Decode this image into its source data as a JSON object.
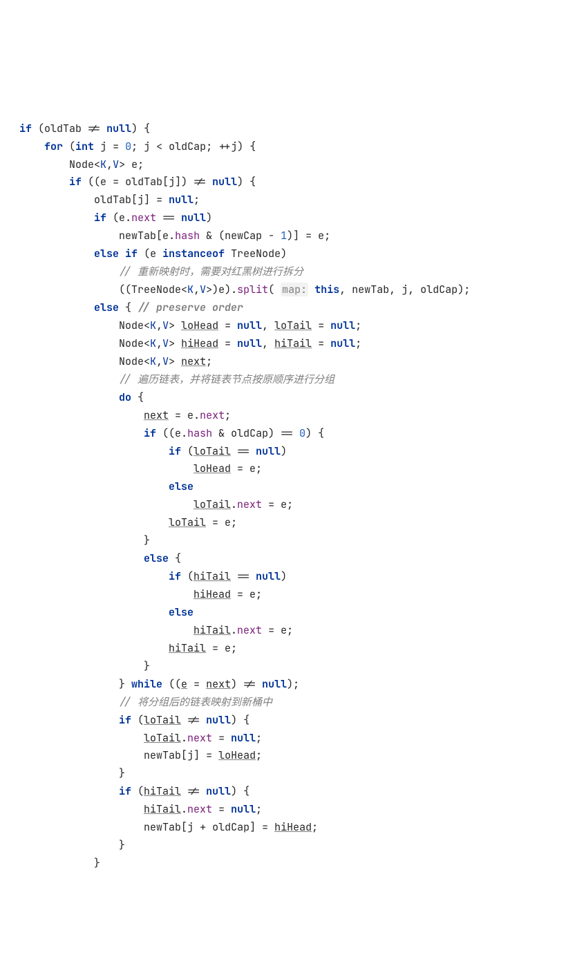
{
  "meta": {
    "language": "Java",
    "context": "HashMap.resize() loop body (decompiled / IDE view)"
  },
  "tokens": {
    "kw_if": "if",
    "kw_else": "else",
    "kw_for": "for",
    "kw_do": "do",
    "kw_while": "while",
    "kw_int": "int",
    "kw_null": "null",
    "kw_instanceof": "instanceof",
    "kw_this": "this",
    "ty_Node": "Node",
    "ty_TreeNode": "TreeNode",
    "ty_K": "K",
    "ty_V": "V",
    "fld_next": "next",
    "fld_hash": "hash",
    "fld_split": "split",
    "var_oldTab": "oldTab",
    "var_newTab": "newTab",
    "var_oldCap": "oldCap",
    "var_newCap": "newCap",
    "var_j": "j",
    "var_e": "e",
    "var_loHead": "loHead",
    "var_loTail": "loTail",
    "var_hiHead": "hiHead",
    "var_hiTail": "hiTail",
    "var_next": "next",
    "hint_map": "map:",
    "num_0": "0",
    "num_1": "1"
  },
  "comments": {
    "c_top_truncated": "",
    "c_split": "// 重新映射时，需要对红黑树进行拆分",
    "c_preserve": "// preserve order",
    "c_group": "// 遍历链表，并将链表节点按原顺序进行分组",
    "c_map_new": "// 将分组后的链表映射到新桶中"
  }
}
